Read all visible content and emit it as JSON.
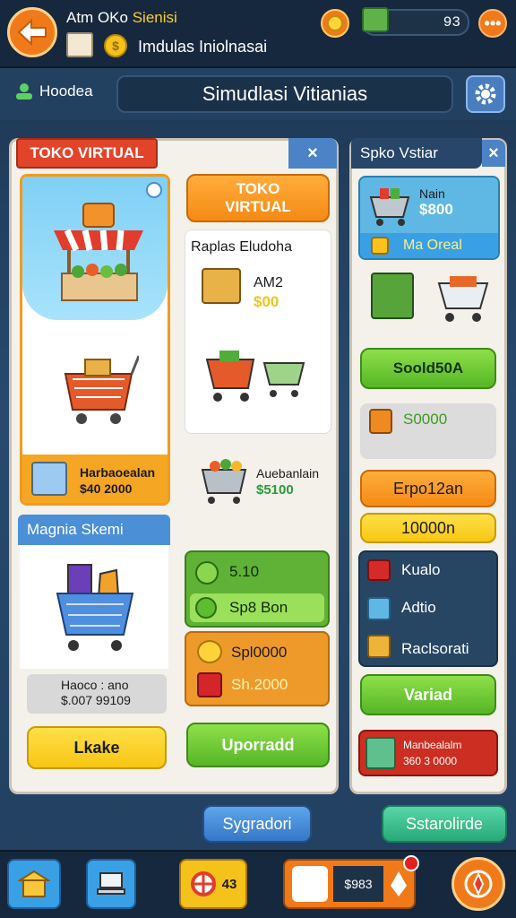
{
  "top": {
    "title_line1": "Atm OKo",
    "title_line1_accent": "Sienisi",
    "title_line2": "Imdulas Iniolnasai",
    "score": "93"
  },
  "subbar": {
    "left_label": "Hoodea",
    "title": "Simudlasi Vitianias"
  },
  "left_panel": {
    "tag": "TOKO VIRTUAL",
    "close": "×",
    "store_card": {
      "item_name": "Harbaoealan",
      "item_price": "$40 2000"
    },
    "main_btn": "TOKO VIRTUAL",
    "list_title": "Raplas Eludoha",
    "list_item1_name": "AM2",
    "list_item1_price": "$00",
    "list_item2_name": "Auebanlain",
    "list_item2_price": "$5100",
    "section2_title": "Magnia Skemi",
    "section2_meta_line1": "Haoco : ano",
    "section2_meta_line2": "$.007 99109",
    "green1": "5.10",
    "green2": "Sp8 Bon",
    "orange1": "Spl0000",
    "orange2": "Sh.2000",
    "btn_left": "Lkake",
    "btn_right": "Uporradd"
  },
  "right_panel": {
    "tag": "Spko Vstiar",
    "close": "×",
    "card1_name": "Nain",
    "card1_price": "$800",
    "card1_badge": "Ma Oreal",
    "btn_green": "Soold50A",
    "row_price": "S0000",
    "btn_orange": "Erpo12an",
    "btn_yellow": "10000n",
    "list": [
      "Kualo",
      "Adtio",
      "Raclsorati"
    ],
    "btn_green2": "Variad",
    "red_line1": "Manbealalm",
    "red_line2": "360 3 0000"
  },
  "footer": {
    "btn_left": "Sygradori",
    "btn_right": "Sstarolirde"
  },
  "bottom": {
    "badge_count": "43",
    "amount": "$983"
  }
}
